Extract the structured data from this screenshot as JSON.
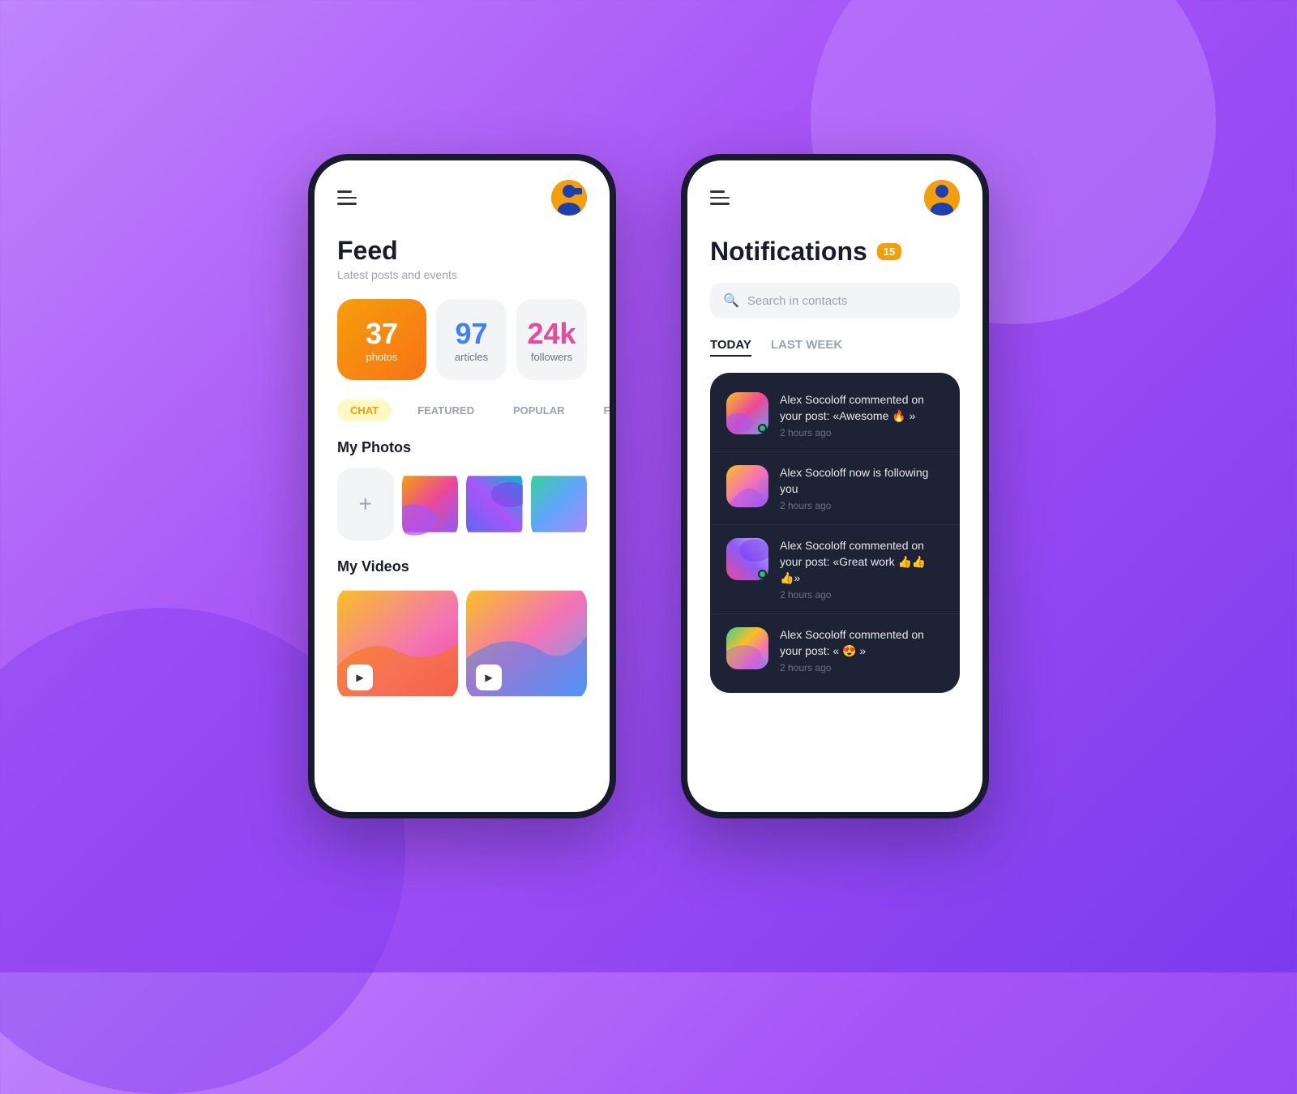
{
  "background": {
    "gradient_start": "#c084fc",
    "gradient_end": "#7c3aed"
  },
  "phone1": {
    "header": {
      "menu_label": "menu",
      "avatar_label": "user avatar"
    },
    "feed": {
      "title": "Feed",
      "subtitle": "Latest posts and events"
    },
    "stats": [
      {
        "num": "37",
        "label": "photos",
        "type": "photos"
      },
      {
        "num": "97",
        "label": "articles",
        "type": "articles"
      },
      {
        "num": "24k",
        "label": "followers",
        "type": "followers"
      }
    ],
    "tabs": [
      {
        "label": "CHAT",
        "active": true
      },
      {
        "label": "FEATURED",
        "active": false
      },
      {
        "label": "POPULAR",
        "active": false
      },
      {
        "label": "FO...",
        "active": false
      }
    ],
    "my_photos_title": "My Photos",
    "my_videos_title": "My Videos"
  },
  "phone2": {
    "header": {
      "menu_label": "menu",
      "avatar_label": "user avatar"
    },
    "notifications": {
      "title": "Notifications",
      "badge": "15",
      "search_placeholder": "Search in contacts",
      "tabs": [
        {
          "label": "TODAY",
          "active": true
        },
        {
          "label": "LAST WEEK",
          "active": false
        }
      ],
      "items": [
        {
          "user": "Alex Socoloff",
          "message": "Alex Socoloff commented on your post: «Awesome 🔥 »",
          "time": "2 hours ago",
          "has_online": true
        },
        {
          "user": "Alex Socoloff",
          "message": "Alex Socoloff now is following you",
          "time": "2 hours ago",
          "has_online": false
        },
        {
          "user": "Alex Socoloff",
          "message": "Alex Socoloff commented on your post: «Great work 👍👍👍»",
          "time": "2 hours ago",
          "has_online": true
        },
        {
          "user": "Alex Socoloff",
          "message": "Alex Socoloff commented on your post: « 😍 »",
          "time": "2 hours ago",
          "has_online": false
        }
      ]
    }
  }
}
